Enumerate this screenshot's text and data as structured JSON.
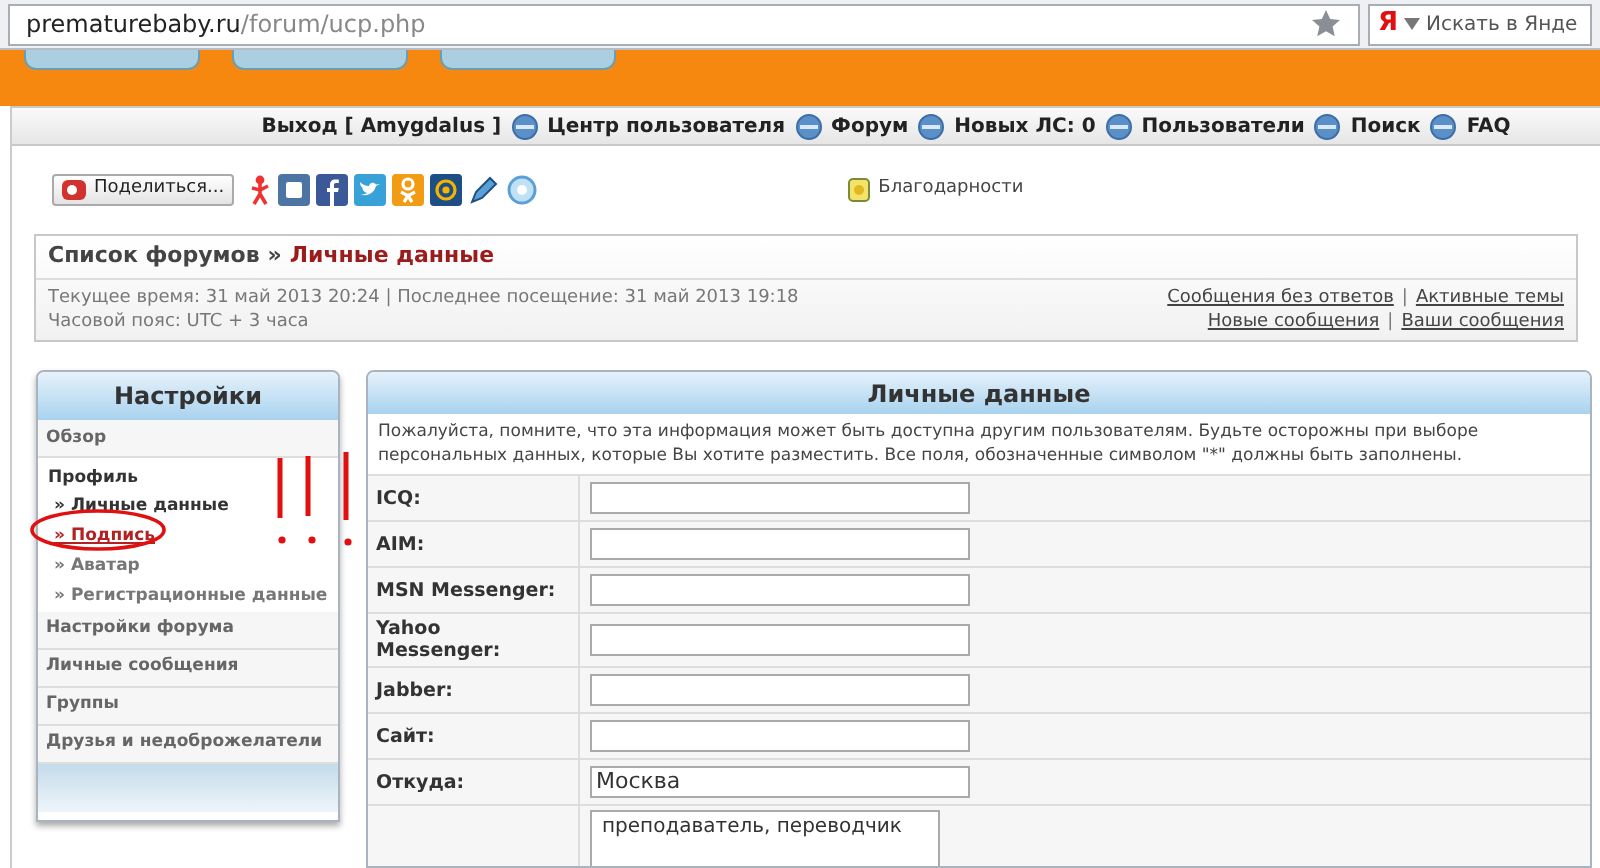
{
  "browser": {
    "url_host": "prematurebaby.ru",
    "url_path": "/forum/ucp.php",
    "search_logo": "Я",
    "search_placeholder": "Искать в Янде"
  },
  "nav": [
    {
      "label": "Выход [ Amygdalus ]"
    },
    {
      "label": "Центр пользователя"
    },
    {
      "label": "Форум"
    },
    {
      "label": "Новых ЛС: 0"
    },
    {
      "label": "Пользователи"
    },
    {
      "label": "Поиск"
    },
    {
      "label": "FAQ"
    }
  ],
  "share": {
    "button": "Поделиться...",
    "thanks": "Благодарности"
  },
  "breadcrumb": {
    "root": "Список форумов",
    "separator": "»",
    "current": "Личные данные"
  },
  "info": {
    "times": "Текущее время: 31 май 2013 20:24 | Последнее посещение: 31 май 2013 19:18",
    "timezone": "Часовой пояс: UTC + 3 часа",
    "links_row_1": [
      "Сообщения без ответов",
      "Активные темы"
    ],
    "links_row_2": [
      "Новые сообщения",
      "Ваши сообщения"
    ],
    "link_separator": "|"
  },
  "sidebar": {
    "title": "Настройки",
    "items": [
      {
        "kind": "section",
        "label": "Обзор"
      },
      {
        "kind": "heading",
        "label": "Профиль"
      },
      {
        "kind": "subitem",
        "label": "» Личные данные",
        "selected": true
      },
      {
        "kind": "link",
        "label": "» Подпись"
      },
      {
        "kind": "subitem",
        "label": "» Аватар",
        "selected": false
      },
      {
        "kind": "subitem",
        "label": "» Регистрационные данные",
        "selected": false
      },
      {
        "kind": "section",
        "label": "Настройки форума"
      },
      {
        "kind": "section",
        "label": "Личные сообщения"
      },
      {
        "kind": "section",
        "label": "Группы"
      },
      {
        "kind": "section",
        "label": "Друзья и недоброжелатели"
      }
    ]
  },
  "panel": {
    "title": "Личные данные",
    "notice": "Пожалуйста, помните, что эта информация может быть доступна другим пользователям. Будьте осторожны при выборе персональных данных, которые Вы хотите разместить. Все поля, обозначенные символом \"*\" должны быть заполнены.",
    "fields": [
      {
        "kind": "input",
        "label": "ICQ:"
      },
      {
        "kind": "input",
        "label": "AIM:"
      },
      {
        "kind": "input",
        "label": "MSN Messenger:"
      },
      {
        "kind": "input",
        "label": "Yahoo Messenger:"
      },
      {
        "kind": "input",
        "label": "Jabber:"
      },
      {
        "kind": "input",
        "label": "Сайт:"
      },
      {
        "kind": "input",
        "label": "Откуда:",
        "value": "Москва"
      },
      {
        "kind": "textarea",
        "value": "преподаватель, переводчик"
      }
    ]
  }
}
